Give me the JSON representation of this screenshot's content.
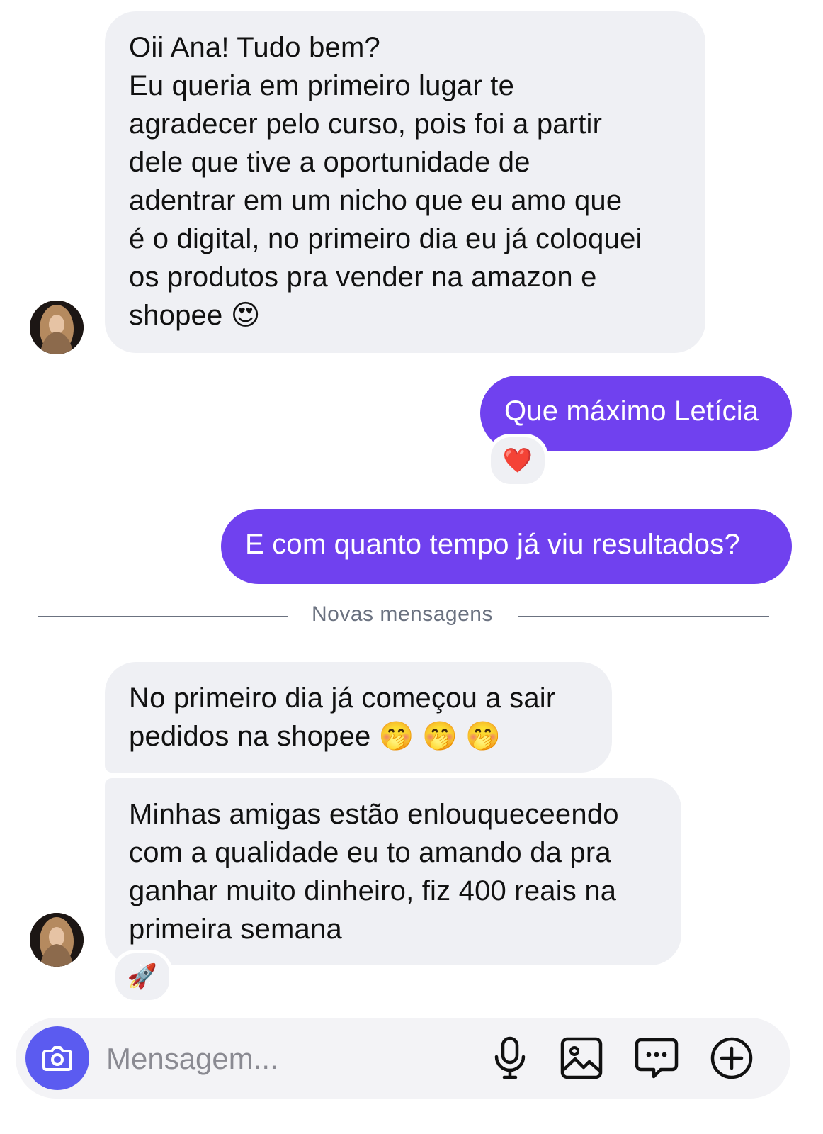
{
  "messages": [
    {
      "from": "contact",
      "lines": [
        "Oii Ana! Tudo bem?",
        "Eu queria em primeiro lugar te",
        "agradecer pelo curso, pois foi a partir",
        "dele que tive a oportunidade de",
        "adentrar em um nicho que eu amo que",
        "é o digital, no primeiro dia eu já coloquei",
        "os produtos pra vender na amazon e",
        "shopee 😍"
      ]
    },
    {
      "from": "me",
      "text": "Que máximo Letícia",
      "reaction": "❤️"
    },
    {
      "from": "me",
      "text": "E com quanto tempo já viu resultados?"
    },
    {
      "from": "contact",
      "lines": [
        "No primeiro dia já começou a sair",
        "pedidos na shopee 🤭 🤭 🤭"
      ]
    },
    {
      "from": "contact",
      "lines": [
        "Minhas amigas estão enlouqueceendo",
        "com a qualidade eu to amando da pra",
        "ganhar muito dinheiro, fiz 400 reais na",
        "primeira semana"
      ],
      "reaction": "🚀"
    }
  ],
  "divider": {
    "label": "Novas mensagens"
  },
  "composer": {
    "placeholder": "Mensagem...",
    "icons": [
      "camera-icon",
      "microphone-icon",
      "image-icon",
      "sticker-chat-icon",
      "plus-circle-icon"
    ],
    "accent": "#5b5bf0"
  },
  "colors": {
    "outgoing": "#7041ef",
    "incoming": "#eff0f4"
  }
}
